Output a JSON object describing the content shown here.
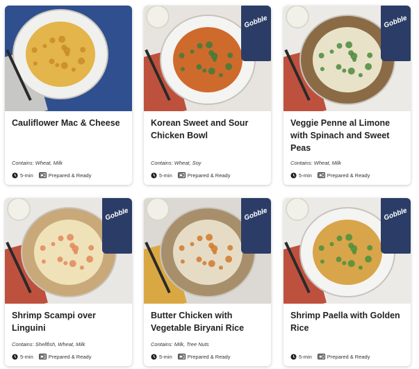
{
  "meals": [
    {
      "title": "Cauliflower Mac & Cheese",
      "contains_label": "Contains:",
      "contains": "Wheat, Milk",
      "time": "5-min",
      "type": "Prepared & Ready",
      "bg": "#2f4f8f",
      "plate": "#f0f0ee",
      "food": "#e3b54a",
      "accent": "#c98b2a",
      "box": false
    },
    {
      "title": "Korean Sweet and Sour Chicken Bowl",
      "contains_label": "Contains:",
      "contains": "Wheat, Soy",
      "time": "5-min",
      "type": "Prepared & Ready",
      "bg": "#e7e4e0",
      "plate": "#f4f4f2",
      "food": "#cf6a2d",
      "accent": "#3f7d3a",
      "box": true,
      "box_label": "Gobble"
    },
    {
      "title": "Veggie Penne al Limone with Spinach and Sweet Peas",
      "contains_label": "Contains:",
      "contains": "Wheat, Milk",
      "time": "5-min",
      "type": "Prepared & Ready",
      "bg": "#eceae7",
      "plate": "#8b6b46",
      "food": "#e8e3c8",
      "accent": "#4d8a3e",
      "box": true,
      "box_label": "Gobble"
    },
    {
      "title": "Shrimp Scampi over Linguini",
      "contains_label": "Contains:",
      "contains": "Shellfish, Wheat, Milk",
      "time": "5-min",
      "type": "Prepared & Ready",
      "bg": "#e9e7e4",
      "plate": "#c9a97a",
      "food": "#f0e2b8",
      "accent": "#e08a5a",
      "box": true,
      "box_label": "Gobble"
    },
    {
      "title": "Butter Chicken with Vegetable Biryani Rice",
      "contains_label": "Contains:",
      "contains": "Milk, Tree Nuts",
      "time": "5-min",
      "type": "Prepared & Ready",
      "bg": "#dcd9d5",
      "plate": "#a88f6b",
      "food": "#e6dcc6",
      "accent": "#d07a2c",
      "box": true,
      "box_label": "Gobble"
    },
    {
      "title": "Shrimp Paella with Golden Rice",
      "contains_label": "",
      "contains": "",
      "time": "5-min",
      "type": "Prepared & Ready",
      "bg": "#eceae7",
      "plate": "#f4f4f2",
      "food": "#d9a54a",
      "accent": "#4b8f3c",
      "box": true,
      "box_label": "Gobble"
    }
  ]
}
